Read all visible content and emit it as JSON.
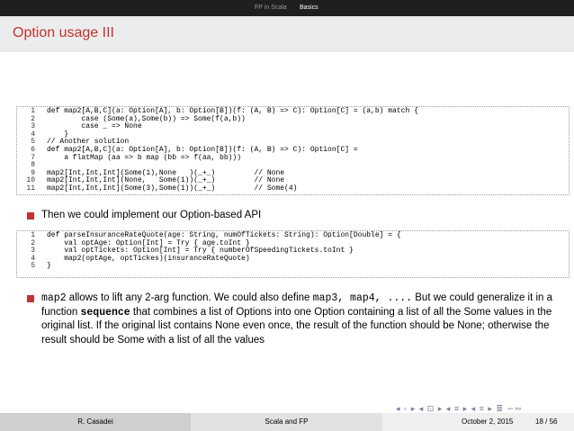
{
  "header": {
    "section_1": "FP in Scala",
    "section_2": "Basics"
  },
  "slide": {
    "title": "Option usage III"
  },
  "code_block_1": {
    "lines": [
      {
        "n": "1",
        "text": "def map2[A,B,C](a: Option[A], b: Option[B])(f: (A, B) => C): Option[C] = (a,b) match {"
      },
      {
        "n": "2",
        "text": "        case (Some(a),Some(b)) => Some(f(a,b))"
      },
      {
        "n": "3",
        "text": "        case _ => None"
      },
      {
        "n": "4",
        "text": "    }"
      },
      {
        "n": "5",
        "text": "// Another solution"
      },
      {
        "n": "6",
        "text": "def map2[A,B,C](a: Option[A], b: Option[B])(f: (A, B) => C): Option[C] ="
      },
      {
        "n": "7",
        "text": "    a flatMap (aa => b map (bb => f(aa, bb)))"
      },
      {
        "n": "8",
        "text": ""
      },
      {
        "n": "9",
        "text": "map2[Int,Int,Int](Some(1),None   )(_+_)         // None"
      },
      {
        "n": "10",
        "text": "map2[Int,Int,Int](None,   Some(1))(_+_)         // None"
      },
      {
        "n": "11",
        "text": "map2[Int,Int,Int](Some(3),Some(1))(_+_)         // Some(4)"
      }
    ]
  },
  "bullet_1": {
    "text": "Then we could implement our Option-based API"
  },
  "code_block_2": {
    "lines": [
      {
        "n": "1",
        "text": "def parseInsuranceRateQuote(age: String, numOfTickets: String): Option[Double] = {"
      },
      {
        "n": "2",
        "text": "    val optAge: Option[Int] = Try { age.toInt }"
      },
      {
        "n": "3",
        "text": "    val optTickets: Option[Int] = Try { numberOfSpeedingTickets.toInt }"
      },
      {
        "n": "4",
        "text": "    map2(optAge, optTickes)(insuranceRateQuote)"
      },
      {
        "n": "5",
        "text": "}"
      }
    ]
  },
  "bullet_2": {
    "code_map2": "map2",
    "part_1": " allows to lift any 2-arg function. We could also define ",
    "code_map34": "map3, map4, ....",
    "part_2": " But we could generalize it in a function ",
    "code_sequence": "sequence",
    "part_3": " that combines a list of Options into one Option containing a list of all the Some values in the original list. If the original list contains None even once, the result of the function should be None; otherwise the result should be Some with a list of all the values"
  },
  "nav_icons": "◂ ▫ ▸ ◂ ⊡ ▸ ◂ ≡ ▸ ◂ ≡ ▸ ≣ ∽∾",
  "footer": {
    "author": "R. Casadei",
    "title": "Scala and FP",
    "date": "October 2, 2015",
    "page": "18 / 56"
  },
  "colors": {
    "accent": "#c33232",
    "header_bg": "#1f1f1f",
    "title_bg": "#ececec"
  }
}
